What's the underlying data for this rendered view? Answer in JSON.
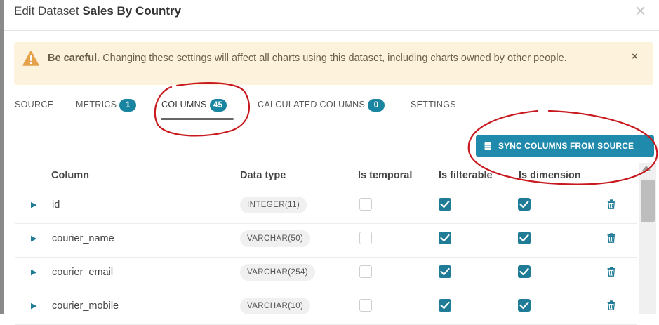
{
  "modal": {
    "title_prefix": "Edit Dataset",
    "title_name": "Sales By Country",
    "close_icon": "close-icon"
  },
  "alert": {
    "strong": "Be careful.",
    "message": "Changing these settings will affect all charts using this dataset, including charts owned by other people.",
    "close": "×",
    "icon": "warning-icon"
  },
  "tabs": [
    {
      "label": "SOURCE"
    },
    {
      "label": "METRICS",
      "badge": "1"
    },
    {
      "label": "COLUMNS",
      "badge": "45"
    },
    {
      "label": "CALCULATED COLUMNS",
      "badge": "0"
    },
    {
      "label": "SETTINGS"
    }
  ],
  "active_tab": "COLUMNS",
  "sync_button": {
    "label": "SYNC COLUMNS FROM SOURCE",
    "icon": "database-icon"
  },
  "table": {
    "headers": [
      "Column",
      "Data type",
      "Is temporal",
      "Is filterable",
      "Is dimension"
    ],
    "rows": [
      {
        "name": "id",
        "type": "INTEGER(11)",
        "temporal": false,
        "filterable": true,
        "dimension": true
      },
      {
        "name": "courier_name",
        "type": "VARCHAR(50)",
        "temporal": false,
        "filterable": true,
        "dimension": true
      },
      {
        "name": "courier_email",
        "type": "VARCHAR(254)",
        "temporal": false,
        "filterable": true,
        "dimension": true
      },
      {
        "name": "courier_mobile",
        "type": "VARCHAR(10)",
        "temporal": false,
        "filterable": true,
        "dimension": true
      }
    ]
  },
  "colors": {
    "accent": "#1f8aab",
    "checkbox": "#1f7b96",
    "alert_bg": "#fdf3dc",
    "annotation": "#c8191e"
  }
}
